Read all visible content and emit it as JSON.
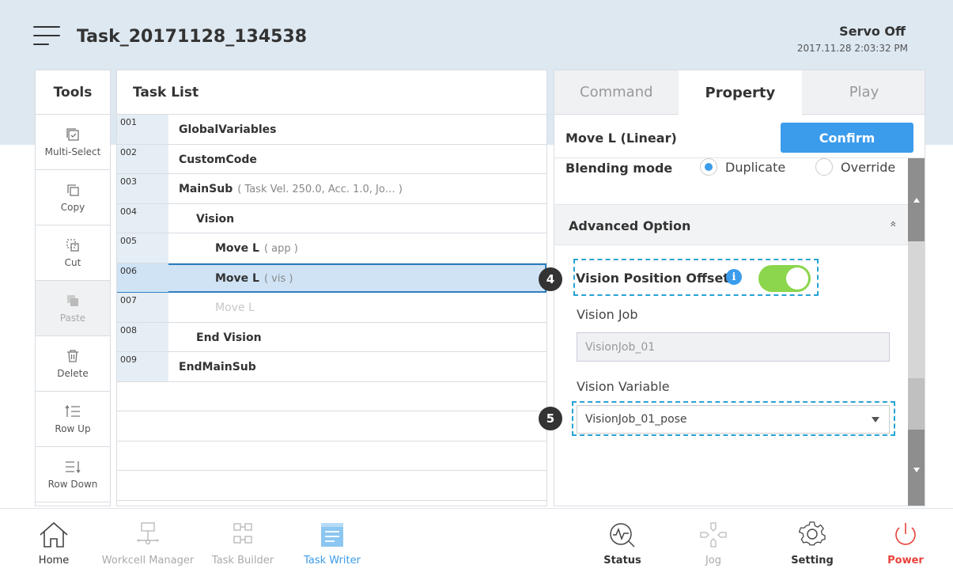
{
  "header": {
    "task_title": "Task_20171128_134538",
    "servo_status": "Servo Off",
    "datetime": "2017.11.28 2:03:32 PM"
  },
  "tools": {
    "heading": "Tools",
    "items": [
      {
        "label": "Multi-Select",
        "icon": "multi-select-icon"
      },
      {
        "label": "Copy",
        "icon": "copy-icon"
      },
      {
        "label": "Cut",
        "icon": "cut-icon"
      },
      {
        "label": "Paste",
        "icon": "paste-icon"
      },
      {
        "label": "Delete",
        "icon": "trash-icon"
      },
      {
        "label": "Row Up",
        "icon": "row-up-icon"
      },
      {
        "label": "Row Down",
        "icon": "row-down-icon"
      }
    ]
  },
  "tasklist": {
    "heading": "Task List",
    "rows": [
      {
        "num": "001",
        "code": "GlobalVariables",
        "param": ""
      },
      {
        "num": "002",
        "code": "CustomCode",
        "param": ""
      },
      {
        "num": "003",
        "code": "MainSub",
        "param": "( Task Vel. 250.0, Acc. 1.0, Jo… )"
      },
      {
        "num": "004",
        "code": "Vision",
        "param": ""
      },
      {
        "num": "005",
        "code": "Move L",
        "param": "( app )"
      },
      {
        "num": "006",
        "code": "Move L",
        "param": "( vis )"
      },
      {
        "num": "007",
        "code": "Move L",
        "param": ""
      },
      {
        "num": "008",
        "code": "End Vision",
        "param": ""
      },
      {
        "num": "009",
        "code": "EndMainSub",
        "param": ""
      }
    ]
  },
  "panel": {
    "tabs": [
      "Command",
      "Property",
      "Play"
    ],
    "active_tab": "Property",
    "property_title": "Move L (Linear)",
    "confirm_label": "Confirm",
    "blending_label": "Blending mode",
    "blending_options": [
      "Duplicate",
      "Override"
    ],
    "blending_selected": "Duplicate",
    "advanced_label": "Advanced Option",
    "advanced_chevron": "»",
    "vision_offset_label": "Vision Position Offset",
    "vision_offset_on": true,
    "vision_job_label": "Vision Job",
    "vision_job_value": "VisionJob_01",
    "vision_variable_label": "Vision Variable",
    "vision_variable_value": "VisionJob_01_pose",
    "callouts": [
      "4",
      "5"
    ]
  },
  "bottom_nav": [
    {
      "label": "Home",
      "icon": "home-icon"
    },
    {
      "label": "Workcell Manager",
      "icon": "workcell-icon"
    },
    {
      "label": "Task Builder",
      "icon": "task-builder-icon"
    },
    {
      "label": "Task Writer",
      "icon": "task-writer-icon"
    },
    {
      "label": "Status",
      "icon": "status-icon"
    },
    {
      "label": "Jog",
      "icon": "jog-icon"
    },
    {
      "label": "Setting",
      "icon": "gear-icon"
    },
    {
      "label": "Power",
      "icon": "power-icon"
    }
  ],
  "colors": {
    "accent": "#3b9cec",
    "toggle_on": "#8bd64c",
    "power": "#e8423b",
    "highlight_dash": "#27a3d3"
  }
}
